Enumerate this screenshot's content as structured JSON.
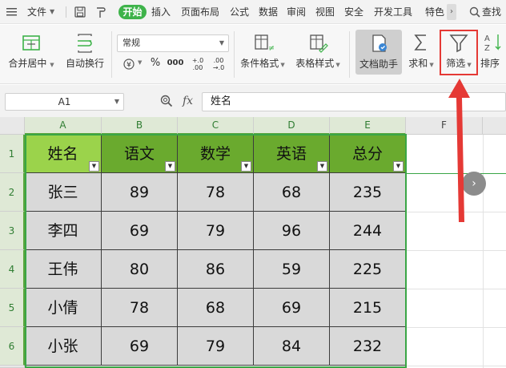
{
  "menubar": {
    "file_label": "文件",
    "tabs": [
      "开始",
      "插入",
      "页面布局",
      "公式",
      "数据",
      "审阅",
      "视图",
      "安全",
      "开发工具",
      "特色"
    ],
    "active_tab": "开始",
    "search_label": "查找"
  },
  "ribbon": {
    "merge_center": "合并居中",
    "wrap_text": "自动换行",
    "number_format": "常规",
    "percent_symbol": "%",
    "thousands_symbol": "000",
    "increase_decimal": "+.0 .00",
    "decrease_decimal": ".00 →.0",
    "conditional_format": "条件格式",
    "table_style": "表格样式",
    "doc_assistant": "文档助手",
    "sum": "求和",
    "filter": "筛选",
    "sort": "排序"
  },
  "formula_bar": {
    "cell_ref": "A1",
    "fx_label": "fx",
    "content": "姓名"
  },
  "sheet": {
    "columns": [
      "A",
      "B",
      "C",
      "D",
      "E",
      "F"
    ],
    "row_numbers": [
      "1",
      "2",
      "3",
      "4",
      "5",
      "6"
    ],
    "headers": [
      "姓名",
      "语文",
      "数学",
      "英语",
      "总分"
    ],
    "rows": [
      [
        "张三",
        "89",
        "78",
        "68",
        "235"
      ],
      [
        "李四",
        "69",
        "79",
        "96",
        "244"
      ],
      [
        "王伟",
        "80",
        "86",
        "59",
        "225"
      ],
      [
        "小倩",
        "78",
        "68",
        "69",
        "215"
      ],
      [
        "小张",
        "69",
        "79",
        "84",
        "232"
      ]
    ],
    "scroll_button": "›"
  },
  "colors": {
    "accent_green": "#3eb34a",
    "header_fill": "#6aaa2e",
    "header_first_fill": "#9bd34b",
    "body_fill": "#d9d9d9",
    "annotation_red": "#e53935"
  }
}
